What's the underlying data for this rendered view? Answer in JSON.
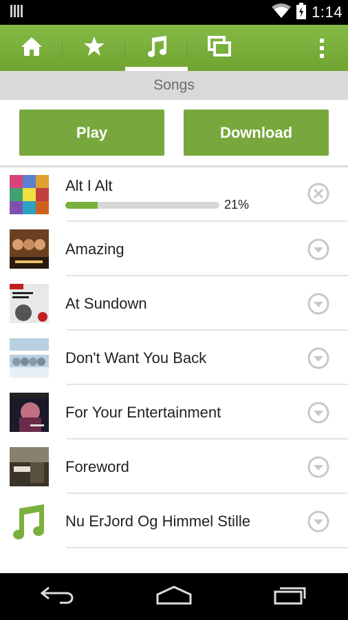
{
  "status_bar": {
    "time": "1:14"
  },
  "action_bar": {
    "tabs": [
      {
        "icon": "home-icon"
      },
      {
        "icon": "star-icon"
      },
      {
        "icon": "music-note-icon",
        "active": true
      },
      {
        "icon": "windows-icon"
      }
    ],
    "overflow_icon": "overflow-menu-icon"
  },
  "subheader": {
    "title": "Songs"
  },
  "buttons": {
    "play_label": "Play",
    "download_label": "Download"
  },
  "songs": [
    {
      "title": "Alt I Alt",
      "progress_text": "21%",
      "progress": 0.21,
      "action_icon": "cancel-icon"
    },
    {
      "title": "Amazing",
      "action_icon": "expand-icon"
    },
    {
      "title": "At Sundown",
      "action_icon": "expand-icon"
    },
    {
      "title": "Don't Want You Back",
      "action_icon": "expand-icon"
    },
    {
      "title": "For Your Entertainment",
      "action_icon": "expand-icon"
    },
    {
      "title": "Foreword",
      "action_icon": "expand-icon"
    },
    {
      "title": "Nu ErJord Og Himmel Stille",
      "action_icon": "expand-icon"
    }
  ],
  "colors": {
    "accent": "#7ab03c",
    "subheader_bg": "#d9d9d9"
  }
}
